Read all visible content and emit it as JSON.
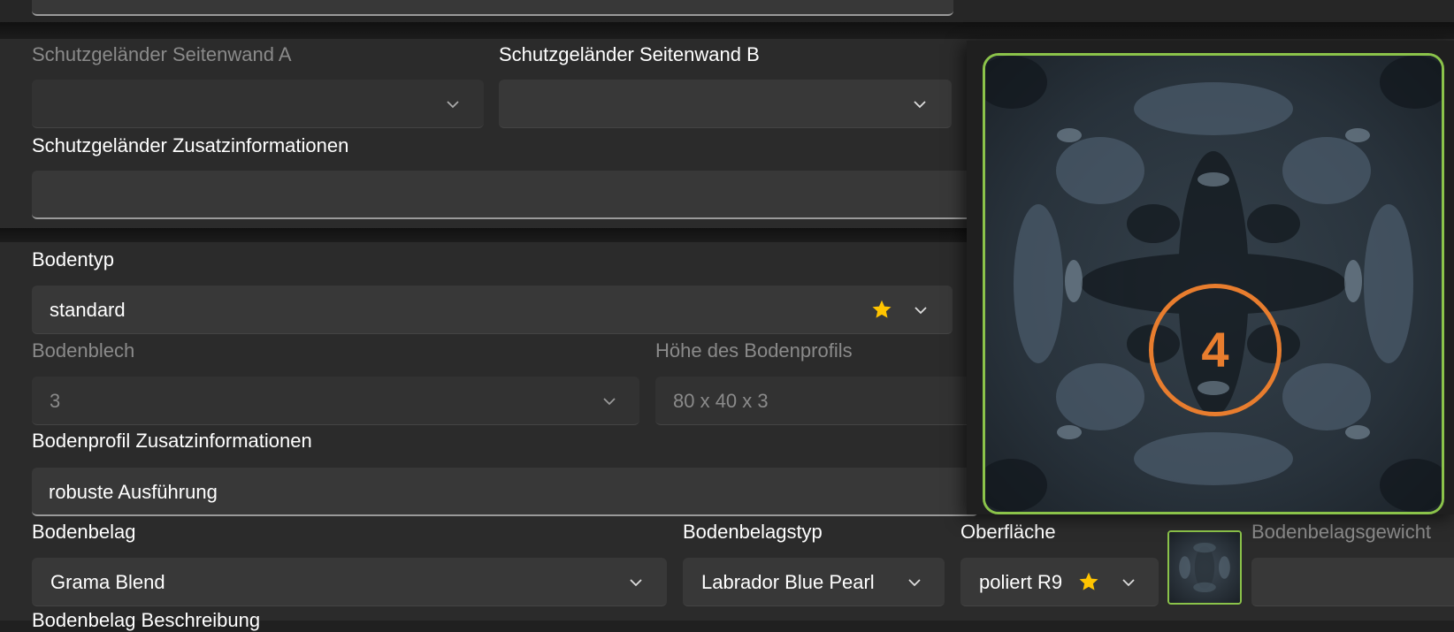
{
  "top_input": {
    "value": ""
  },
  "guardrail": {
    "side_a": {
      "label": "Schutzgeländer Seitenwand A",
      "value": ""
    },
    "side_b": {
      "label": "Schutzgeländer Seitenwand B",
      "value": ""
    },
    "extra": {
      "label": "Schutzgeländer Zusatzinformationen",
      "value": ""
    }
  },
  "floor": {
    "type": {
      "label": "Bodentyp",
      "value": "standard",
      "favorite_icon": "star-icon"
    },
    "sheet": {
      "label": "Bodenblech",
      "value": "3"
    },
    "profile_height": {
      "label": "Höhe des Bodenprofils",
      "value": "80 x 40 x 3"
    },
    "profile_extra": {
      "label": "Bodenprofil Zusatzinformationen",
      "value": "robuste Ausführung"
    },
    "covering": {
      "label": "Bodenbelag",
      "value": "Grama Blend"
    },
    "covering_type": {
      "label": "Bodenbelagstyp",
      "value": "Labrador Blue Pearl"
    },
    "surface": {
      "label": "Oberfläche",
      "value": "poliert R9",
      "favorite_icon": "star-icon"
    },
    "covering_weight": {
      "label": "Bodenbelagsgewicht",
      "value": ""
    },
    "covering_description": {
      "label": "Bodenbelag Beschreibung"
    }
  },
  "preview": {
    "badge": "4",
    "accent": "#8bc34a",
    "badge_color": "#e87d2e"
  },
  "colors": {
    "background": "#202020",
    "panel": "#2b2b2b",
    "field": "#383838",
    "star": "#ffc400"
  }
}
